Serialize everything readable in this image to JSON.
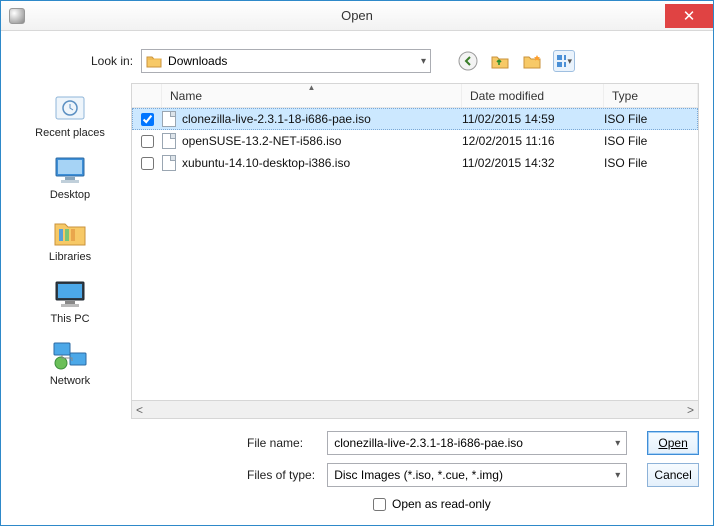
{
  "window": {
    "title": "Open"
  },
  "lookin": {
    "label": "Look in:",
    "value": "Downloads"
  },
  "toolbar": {
    "back": "back-icon",
    "up": "up-folder-icon",
    "new_folder": "new-folder-icon",
    "view": "view-menu-icon"
  },
  "columns": {
    "name": "Name",
    "date": "Date modified",
    "type": "Type"
  },
  "files": [
    {
      "checked": true,
      "selected": true,
      "name": "clonezilla-live-2.3.1-18-i686-pae.iso",
      "date": "11/02/2015 14:59",
      "type": "ISO File"
    },
    {
      "checked": false,
      "selected": false,
      "name": "openSUSE-13.2-NET-i586.iso",
      "date": "12/02/2015 11:16",
      "type": "ISO File"
    },
    {
      "checked": false,
      "selected": false,
      "name": "xubuntu-14.10-desktop-i386.iso",
      "date": "11/02/2015 14:32",
      "type": "ISO File"
    }
  ],
  "places": {
    "recent": "Recent places",
    "desktop": "Desktop",
    "libraries": "Libraries",
    "thispc": "This PC",
    "network": "Network"
  },
  "bottom": {
    "filename_label": "File name:",
    "filename_value": "clonezilla-live-2.3.1-18-i686-pae.iso",
    "filter_label": "Files of type:",
    "filter_value": "Disc Images (*.iso, *.cue, *.img)",
    "readonly_label": "Open as read-only",
    "open": "Open",
    "cancel": "Cancel"
  }
}
